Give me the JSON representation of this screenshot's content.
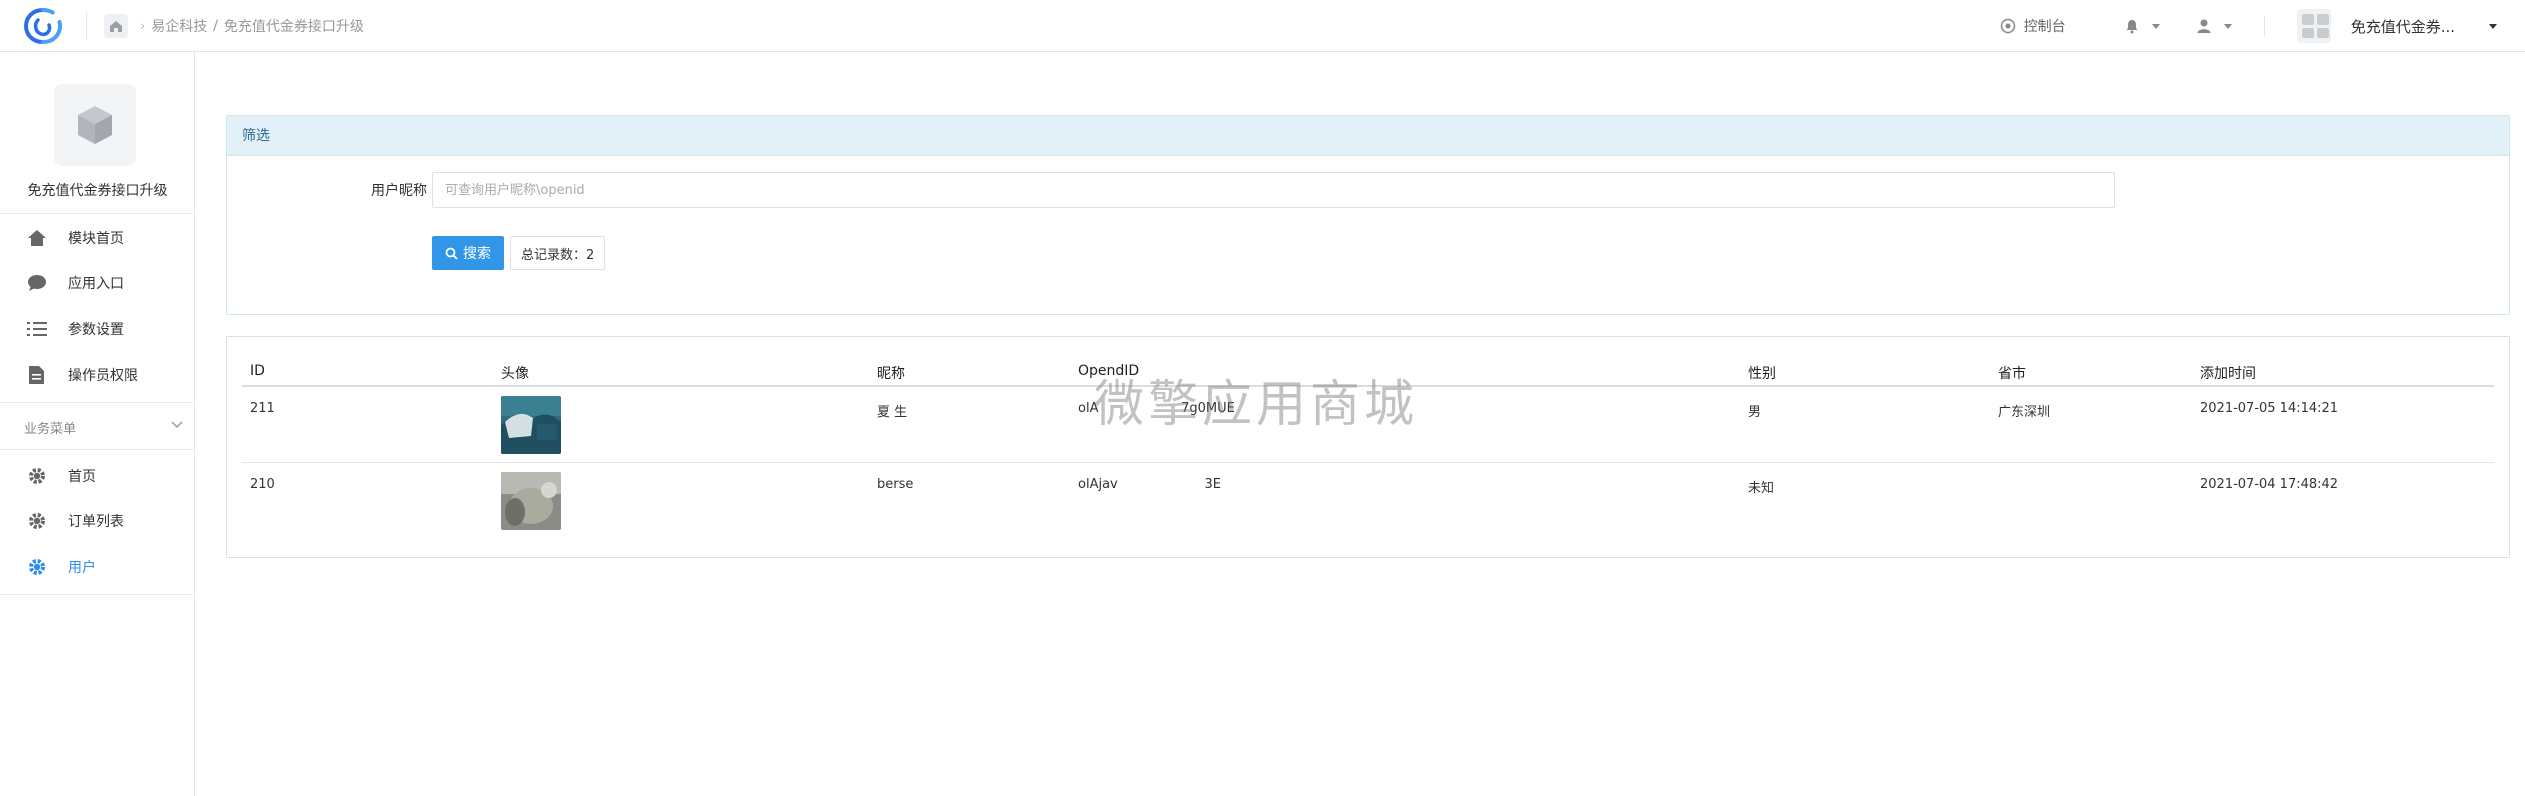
{
  "topbar": {
    "breadcrumb": [
      "易企科技",
      "/",
      "免充值代金券接口升级"
    ],
    "console_label": "控制台",
    "app_name": "免充值代金券..."
  },
  "sidebar": {
    "app_title": "免充值代金券接口升级",
    "items": [
      {
        "label": "模块首页",
        "icon": "home-icon"
      },
      {
        "label": "应用入口",
        "icon": "chat-icon"
      },
      {
        "label": "参数设置",
        "icon": "list-icon"
      },
      {
        "label": "操作员权限",
        "icon": "document-icon"
      }
    ],
    "section_label": "业务菜单",
    "business_items": [
      {
        "label": "首页",
        "icon": "gear-icon"
      },
      {
        "label": "订单列表",
        "icon": "gear-icon"
      },
      {
        "label": "用户",
        "icon": "gear-icon",
        "active": true
      }
    ]
  },
  "filter": {
    "title": "筛选",
    "field_label": "用户昵称",
    "placeholder": "可查询用户昵称\\openid",
    "search_label": "搜索",
    "total_label": "总记录数：2"
  },
  "table": {
    "headers": [
      "ID",
      "头像",
      "昵称",
      "OpendID",
      "性别",
      "省市",
      "添加时间"
    ],
    "rows": [
      {
        "id": "211",
        "nickname": "夏  生",
        "openid": "olA                    7g0MUE",
        "gender": "男",
        "region": "广东深圳",
        "added": "2021-07-05 14:14:21"
      },
      {
        "id": "210",
        "nickname": "berse   ",
        "openid": "olAjav                     3E",
        "gender": "未知",
        "region": "",
        "added": "2021-07-04 17:48:42"
      }
    ]
  },
  "watermark": "微擎应用商城",
  "colors": {
    "accent": "#2d8cf0",
    "button": "#3296e8",
    "filter_header": "#e2f1f8"
  }
}
